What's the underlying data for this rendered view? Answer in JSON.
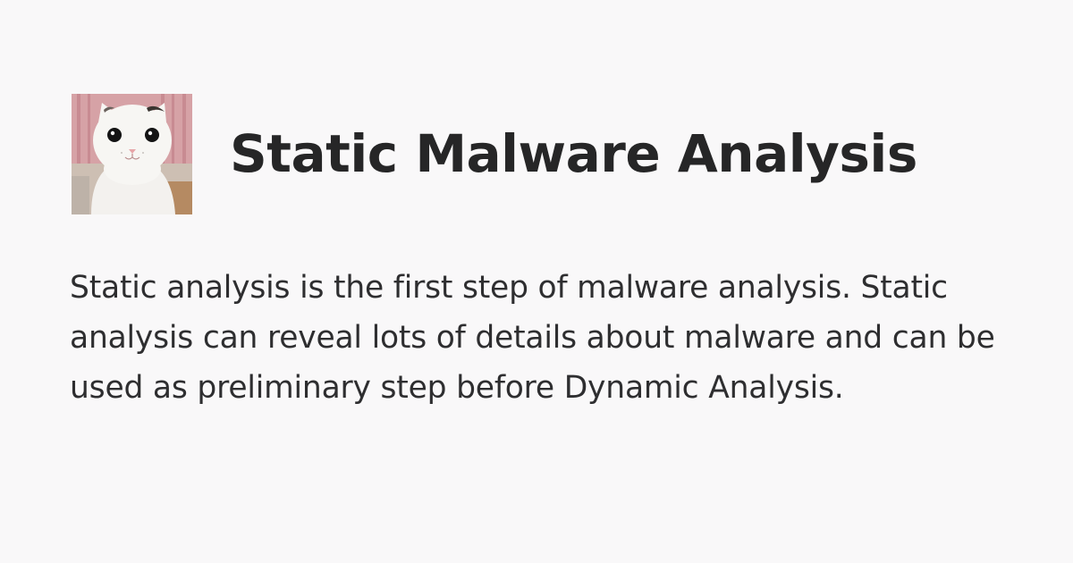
{
  "page": {
    "title": "Static Malware Analysis",
    "description": "Static analysis is the first step of malware analysis. Static analysis can reveal lots of details about malware and can be used as preliminary step before Dynamic Analysis."
  },
  "colors": {
    "background": "#f9f8f9",
    "title": "#262627",
    "text": "#2e2e30"
  },
  "avatar": {
    "icon": "cat-avatar-icon"
  }
}
